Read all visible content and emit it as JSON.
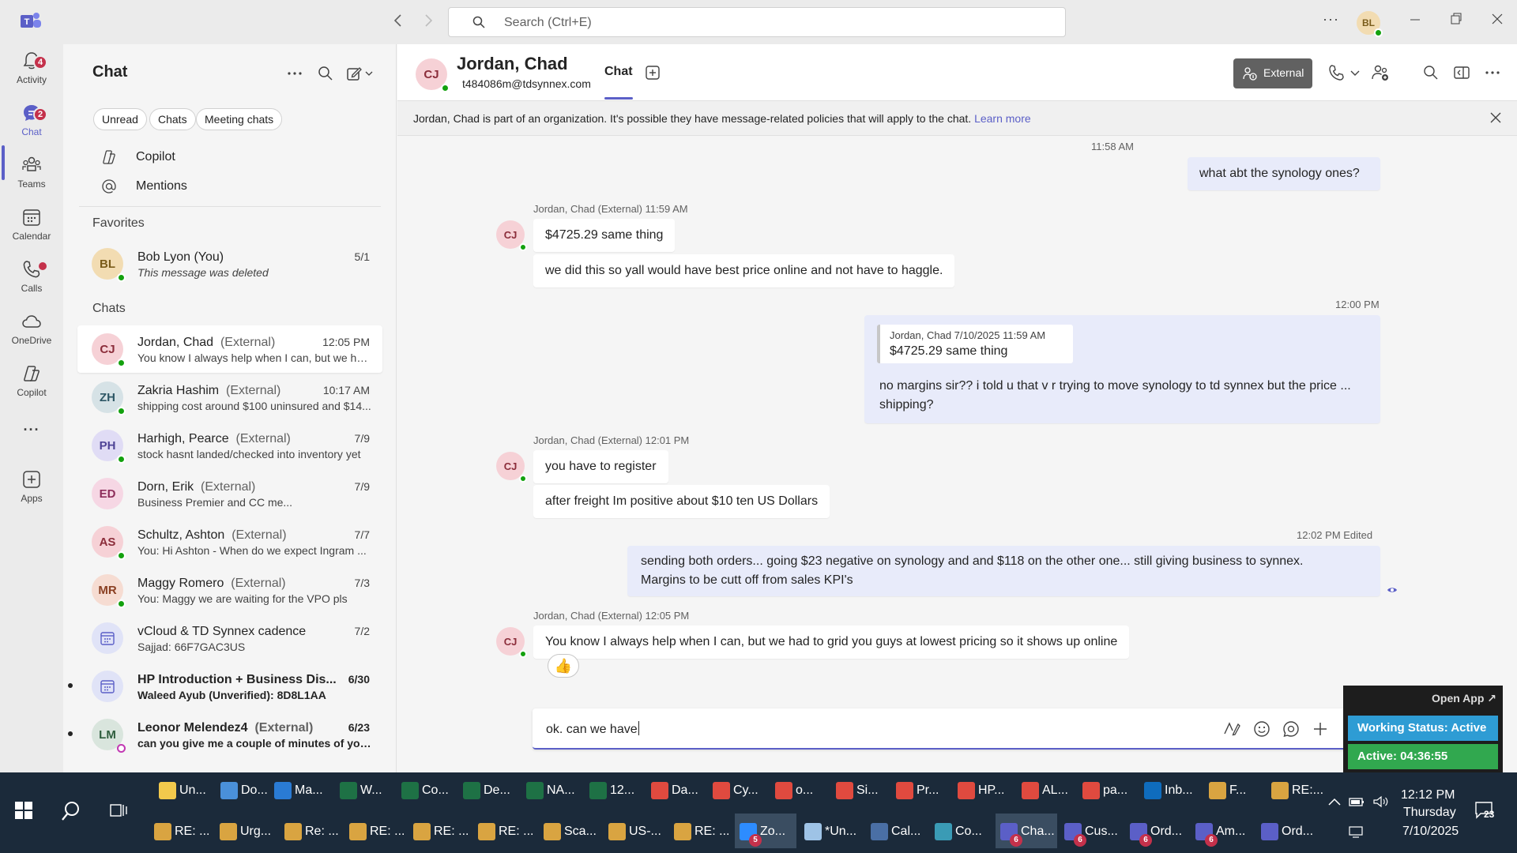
{
  "colors": {
    "brand": "#5b5fc7",
    "presence_available": "#13a10e",
    "badge": "#c4314b",
    "mine_bubble": "#e8ebfa"
  },
  "titlebar": {
    "search_placeholder": "Search (Ctrl+E)",
    "more_label": "···",
    "user_initials": "BL",
    "back_icon": "chevron-left-icon",
    "forward_icon": "chevron-right-icon"
  },
  "rail": {
    "items": [
      {
        "label": "Activity",
        "icon": "bell-icon",
        "badge": "4"
      },
      {
        "label": "Chat",
        "icon": "chat-icon",
        "badge": "2"
      },
      {
        "label": "Teams",
        "icon": "teams-icon"
      },
      {
        "label": "Calendar",
        "icon": "calendar-icon"
      },
      {
        "label": "Calls",
        "icon": "phone-icon"
      },
      {
        "label": "OneDrive",
        "icon": "cloud-icon"
      },
      {
        "label": "Copilot",
        "icon": "copilot-icon"
      },
      {
        "label": "Apps",
        "icon": "plus-box-icon"
      }
    ],
    "more_label": "···"
  },
  "chatlist": {
    "title": "Chat",
    "filters": [
      "Unread",
      "Chats",
      "Meeting chats"
    ],
    "quick_links": [
      "Copilot",
      "Mentions"
    ],
    "favorites_title": "Favorites",
    "chats_title": "Chats",
    "favorites": [
      {
        "initials": "BL",
        "name": "Bob Lyon (You)",
        "time": "5/1",
        "preview": "This message was deleted"
      }
    ],
    "chats": [
      {
        "initials": "CJ",
        "name": "Jordan, Chad",
        "ext": "(External)",
        "time": "12:05 PM",
        "preview": "You know I always help when I can, but we ha..."
      },
      {
        "initials": "ZH",
        "name": "Zakria Hashim",
        "ext": "(External)",
        "time": "10:17 AM",
        "preview": "shipping cost around $100 uninsured and $14..."
      },
      {
        "initials": "PH",
        "name": "Harhigh, Pearce",
        "ext": "(External)",
        "time": "7/9",
        "preview": "stock hasnt landed/checked into inventory yet"
      },
      {
        "initials": "ED",
        "name": "Dorn, Erik",
        "ext": "(External)",
        "time": "7/9",
        "preview": "Business Premier and CC me..."
      },
      {
        "initials": "AS",
        "name": "Schultz, Ashton",
        "ext": "(External)",
        "time": "7/7",
        "preview": "You: Hi Ashton -  When do we expect Ingram ..."
      },
      {
        "initials": "MR",
        "name": "Maggy Romero",
        "ext": "(External)",
        "time": "7/3",
        "preview": "You: Maggy we are waiting for the VPO pls"
      },
      {
        "initials": "",
        "name": "vCloud & TD Synnex cadence",
        "ext": "",
        "time": "7/2",
        "preview": "Sajjad: 66F7GAC3US"
      },
      {
        "initials": "",
        "name": "HP Introduction + Business Dis...",
        "ext": "",
        "time": "6/30",
        "preview": "Waleed Ayub (Unverified): 8D8L1AA"
      },
      {
        "initials": "LM",
        "name": "Leonor Melendez4",
        "ext": "(External)",
        "time": "6/23",
        "preview": "can you give me a couple of minutes of your..."
      }
    ]
  },
  "header": {
    "initials": "CJ",
    "name": "Jordan, Chad",
    "email": "t484086m@tdsynnex.com",
    "tab": "Chat",
    "external_label": "External"
  },
  "banner": {
    "text": "Jordan, Chad is part of an organization. It's possible they have message-related policies that will apply to the chat.",
    "link": "Learn more"
  },
  "messages": {
    "m1_time": "11:58 AM",
    "m1_text": "what abt the synology ones?",
    "g1_meta": "Jordan, Chad (External)   11:59 AM",
    "g1_a": "$4725.29 same thing",
    "g1_b": "we did this so yall would have best price online and not have to haggle.",
    "m2_time": "12:00 PM",
    "quote_meta": "Jordan, Chad   7/10/2025 11:59 AM",
    "quote_text": "$4725.29 same thing",
    "m2_line1": "no margins sir?? i told u that v r trying to move synology to td synnex but the price ...",
    "m2_line2": "shipping?",
    "g2_meta": "Jordan, Chad (External)   12:01 PM",
    "g2_a": "you have to register",
    "g2_b": "after freight Im positive about $10 ten US Dollars",
    "m3_time": "12:02 PM   Edited",
    "m3_line1": "sending both orders... going $23 negative on synology and and $118 on the other one... still giving business to synnex.",
    "m3_line2": "Margins to be cutt off from sales KPI's",
    "g3_meta": "Jordan, Chad (External)   12:05 PM",
    "g3_a": "You know I always help when I can, but we had to grid you guys at lowest pricing so it shows up online",
    "reaction": "👍"
  },
  "composer": {
    "text": "ok. can we have"
  },
  "status_widget": {
    "open_app": "Open App ↗",
    "working_status": "Working Status: Active",
    "active_timer": "Active: 04:36:55"
  },
  "taskbar": {
    "row1": [
      "Un...",
      "Do...",
      "Ma...",
      "W...",
      "Co...",
      "De...",
      "NA...",
      "12...",
      "Da...",
      "Cy...",
      "o...",
      "Si...",
      "Pr...",
      "HP...",
      "AL...",
      "pa...",
      "Inb...",
      "F...",
      "RE:..."
    ],
    "row2": [
      "RE: ...",
      "Urg...",
      "Re: ...",
      "RE: ...",
      "RE: ...",
      "RE: ...",
      "Sca...",
      "US-...",
      "RE: ...",
      "Zo...",
      "*Un...",
      "Cal...",
      "Co...",
      "Cha...",
      "Cus...",
      "Ord...",
      "Am...",
      "Ord..."
    ],
    "row2_counts": {
      "9": "5",
      "13": "6",
      "14": "6",
      "15": "6",
      "16": "6"
    },
    "time": "12:12 PM",
    "day": "Thursday",
    "date": "7/10/2025",
    "notifications": "23"
  }
}
